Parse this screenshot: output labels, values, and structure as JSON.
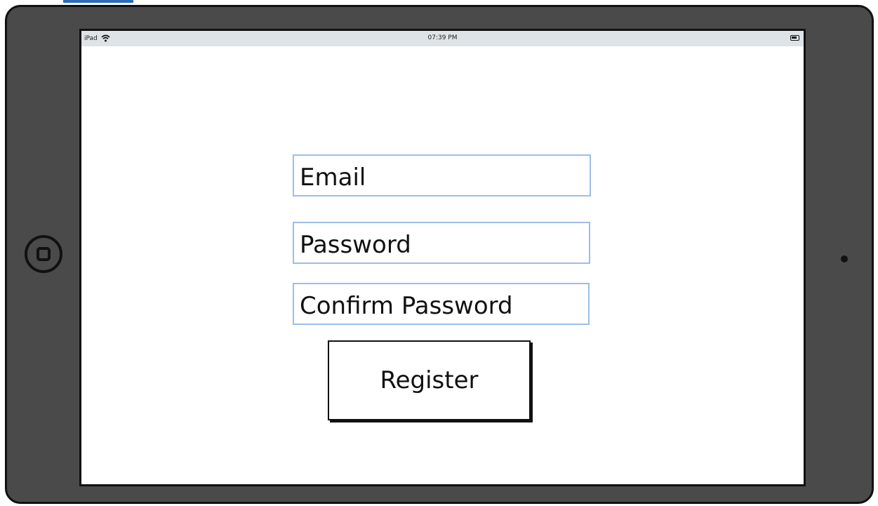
{
  "status_bar": {
    "device_label": "iPad",
    "time": "07:39 PM",
    "wifi_icon": "wifi-icon",
    "battery_icon": "battery-icon"
  },
  "form": {
    "email": {
      "value": "",
      "placeholder": "Email"
    },
    "password": {
      "value": "",
      "placeholder": "Password"
    },
    "confirm_password": {
      "value": "",
      "placeholder": "Confirm Password"
    },
    "register_label": "Register"
  },
  "hardware": {
    "home_button_icon": "home-button-icon",
    "camera_icon": "camera-icon"
  },
  "colors": {
    "bezel": "#4a4a4a",
    "status_bar": "#dde3e6",
    "field_border": "#9dbde9",
    "top_sliver": "#2e6db4"
  }
}
